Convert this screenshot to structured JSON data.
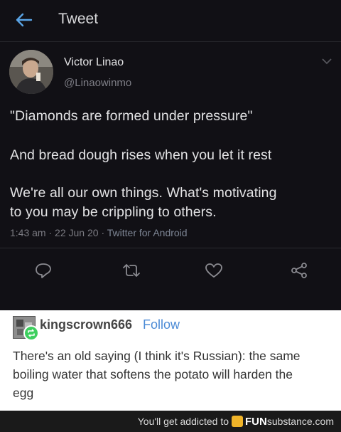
{
  "header": {
    "title": "Tweet"
  },
  "tweet": {
    "author_name": "Victor Linao",
    "author_handle": "@Linaowinmo",
    "lines": [
      "\"Diamonds are formed under pressure\"",
      "And bread dough rises when you let it rest",
      "We're all our own things. What's motivating",
      "to you may be crippling to others."
    ],
    "time": "1:43 am",
    "date": "22 Jun 20",
    "source": "Twitter for Android"
  },
  "tumblr": {
    "username": "kingscrown666",
    "follow_label": "Follow",
    "lines": [
      "There's an old saying (I think it's Russian): the same",
      "boiling water that softens the potato will harden the",
      "egg"
    ]
  },
  "footer": {
    "text": "You'll get addicted to",
    "brand_prefix": "FUN",
    "brand_suffix": "substance.com"
  },
  "colors": {
    "tweet_bg": "#111015",
    "follow_blue": "#4c8bd6",
    "reblog_green": "#3ecf5f"
  },
  "icons": [
    "back-arrow-icon",
    "chevron-down-icon",
    "reply-icon",
    "retweet-icon",
    "like-icon",
    "share-icon",
    "reblog-icon",
    "funsubstance-logo-icon"
  ]
}
